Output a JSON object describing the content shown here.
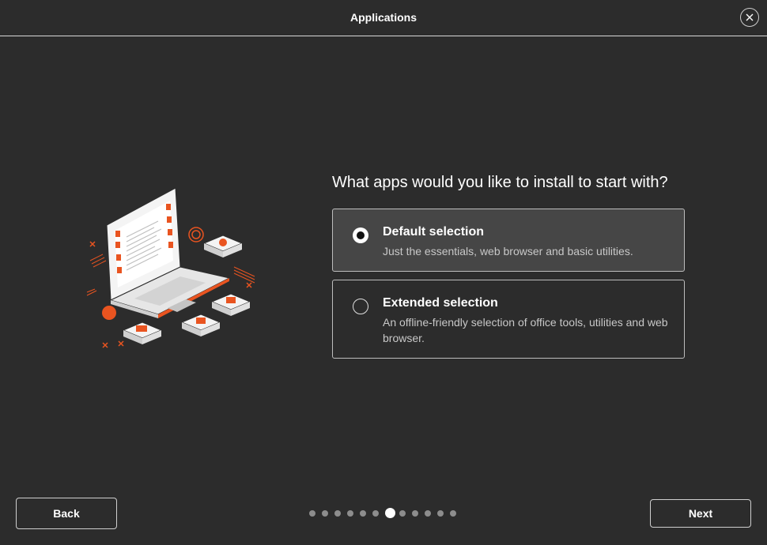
{
  "window": {
    "title": "Applications",
    "close_icon": "close-icon"
  },
  "question": "What apps would you like to install to start with?",
  "options": [
    {
      "title": "Default selection",
      "description": "Just the essentials, web browser and basic utilities.",
      "selected": true
    },
    {
      "title": "Extended selection",
      "description": "An offline-friendly selection of office tools, utilities and web browser.",
      "selected": false
    }
  ],
  "buttons": {
    "back": "Back",
    "next": "Next"
  },
  "pagination": {
    "total": 12,
    "current": 7
  },
  "colors": {
    "background": "#2c2c2c",
    "accent": "#e95420",
    "selected_bg": "#464646"
  }
}
